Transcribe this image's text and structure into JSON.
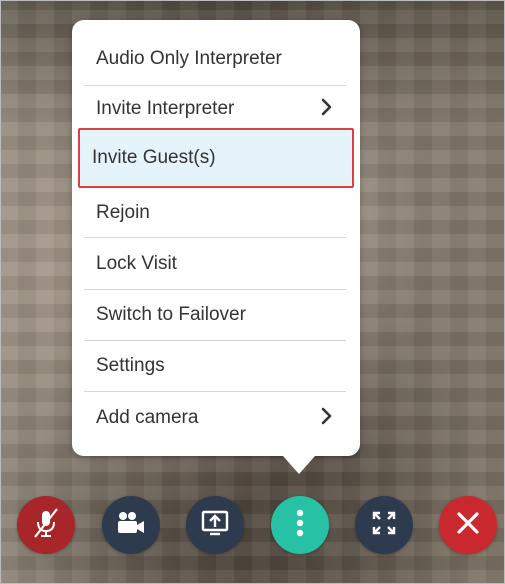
{
  "menu": {
    "items": [
      {
        "label": "Audio Only Interpreter",
        "has_submenu": false
      },
      {
        "label": "Invite Interpreter",
        "has_submenu": true
      },
      {
        "label": "Invite Guest(s)",
        "has_submenu": false,
        "highlighted": true
      },
      {
        "label": "Rejoin",
        "has_submenu": false
      },
      {
        "label": "Lock Visit",
        "has_submenu": false
      },
      {
        "label": "Switch to Failover",
        "has_submenu": false
      },
      {
        "label": "Settings",
        "has_submenu": false
      },
      {
        "label": "Add camera",
        "has_submenu": true
      }
    ],
    "highlight_color": "#d9403f",
    "highlight_background": "#e4f4fa"
  },
  "controls": [
    {
      "icon": "microphone-muted-icon",
      "color": "#a8252a"
    },
    {
      "icon": "video-camera-icon",
      "color": "#2e3b4f"
    },
    {
      "icon": "share-screen-icon",
      "color": "#2e3b4f"
    },
    {
      "icon": "more-options-icon",
      "color": "#27c2a6"
    },
    {
      "icon": "fullscreen-icon",
      "color": "#2e3b4f"
    },
    {
      "icon": "end-call-icon",
      "color": "#c9292e"
    }
  ]
}
